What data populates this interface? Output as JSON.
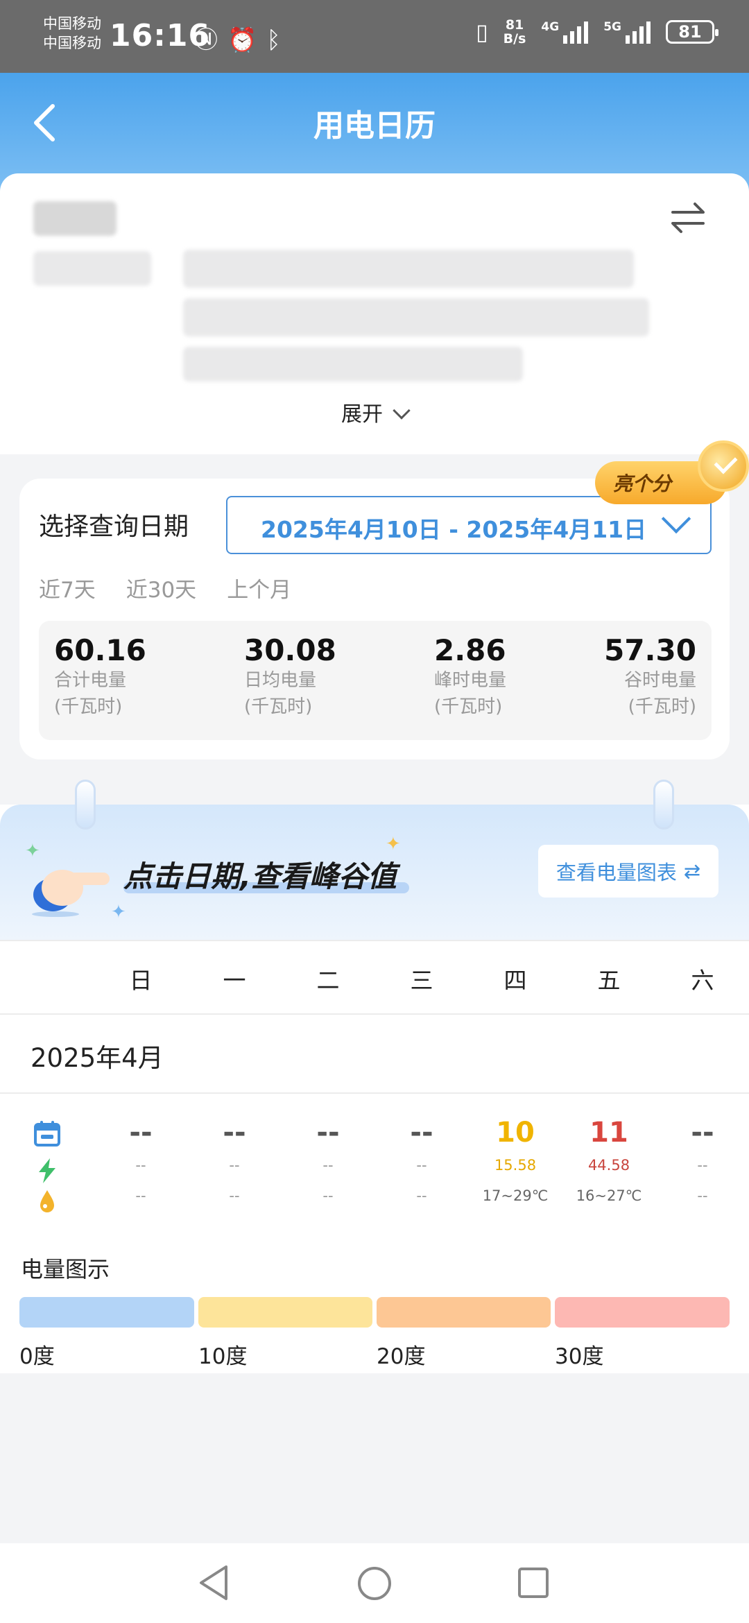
{
  "status_bar": {
    "carrier_1": "中国移动",
    "carrier_2": "中国移动",
    "time": "16:16",
    "net_speed_value": "81",
    "net_speed_unit": "B/s",
    "net_1": "4G",
    "net_2": "5G",
    "battery": "81"
  },
  "header": {
    "title": "用电日历"
  },
  "account": {
    "expand_label": "展开"
  },
  "badge": {
    "label": "亮个分"
  },
  "query": {
    "label": "选择查询日期",
    "date_range": "2025年4月10日 - 2025年4月11日",
    "quick_ranges": [
      "近7天",
      "近30天",
      "上个月"
    ],
    "stats": [
      {
        "value": "60.16",
        "label": "合计电量",
        "unit": "(千瓦时)"
      },
      {
        "value": "30.08",
        "label": "日均电量",
        "unit": "(千瓦时)"
      },
      {
        "value": "2.86",
        "label": "峰时电量",
        "unit": "(千瓦时)"
      },
      {
        "value": "57.30",
        "label": "谷时电量",
        "unit": "(千瓦时)"
      }
    ]
  },
  "calendar": {
    "promo": "点击日期,查看峰谷值",
    "chart_button": "查看电量图表",
    "weekdays": [
      "日",
      "一",
      "二",
      "三",
      "四",
      "五",
      "六"
    ],
    "month": "2025年4月",
    "days": [
      {
        "day": "--",
        "kwh": "--",
        "temp": "--",
        "color": "#555555"
      },
      {
        "day": "--",
        "kwh": "--",
        "temp": "--",
        "color": "#555555"
      },
      {
        "day": "--",
        "kwh": "--",
        "temp": "--",
        "color": "#555555"
      },
      {
        "day": "--",
        "kwh": "--",
        "temp": "--",
        "color": "#555555"
      },
      {
        "day": "10",
        "kwh": "15.58",
        "temp": "17~29℃",
        "color": "#f0b400"
      },
      {
        "day": "11",
        "kwh": "44.58",
        "temp": "16~27℃",
        "color": "#d9463e"
      },
      {
        "day": "--",
        "kwh": "--",
        "temp": "--",
        "color": "#555555"
      }
    ]
  },
  "legend": {
    "title": "电量图示",
    "items": [
      {
        "label": "0度",
        "color": "#b3d4f7"
      },
      {
        "label": "10度",
        "color": "#fde49a"
      },
      {
        "label": "20度",
        "color": "#fdc794"
      },
      {
        "label": "30度",
        "color": "#fdb8b3"
      }
    ]
  }
}
